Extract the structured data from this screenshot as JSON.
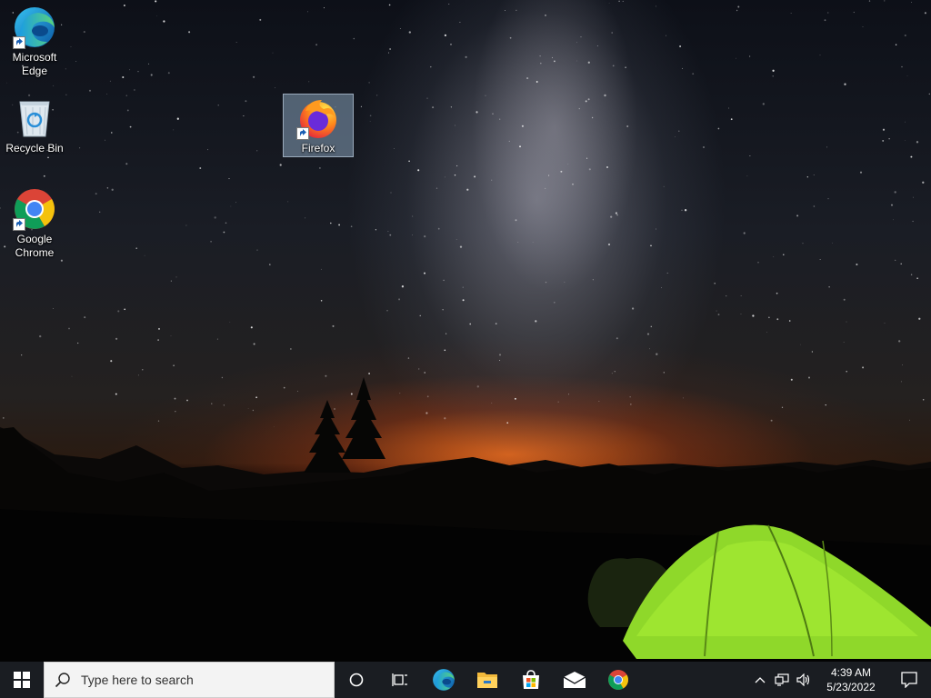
{
  "desktop": {
    "icons": [
      {
        "label": "Microsoft Edge",
        "icon": "edge-icon",
        "shortcut": true
      },
      {
        "label": "Recycle Bin",
        "icon": "recycle-bin-icon",
        "shortcut": false
      },
      {
        "label": "Google Chrome",
        "icon": "chrome-icon",
        "shortcut": true
      },
      {
        "label": "Firefox",
        "icon": "firefox-icon",
        "shortcut": true,
        "selected": true
      }
    ]
  },
  "taskbar": {
    "start_icon": "windows-logo-icon",
    "search_placeholder": "Type here to search",
    "cortana_icon": "cortana-circle-icon",
    "task_view_icon": "task-view-icon",
    "pinned_apps": [
      "edge-icon",
      "file-explorer-icon",
      "microsoft-store-icon",
      "mail-icon",
      "chrome-icon"
    ],
    "tray": {
      "icons": [
        "chevron-up-icon",
        "network-icon",
        "volume-icon"
      ],
      "time": "4:39 AM",
      "date": "5/23/2022",
      "notification_icon": "action-center-icon"
    }
  },
  "colors": {
    "taskbar_bg": "#1a1d22",
    "search_bg": "#f3f3f3",
    "tent_green": "#9be22a",
    "horizon_orange": "#f06e1e"
  }
}
